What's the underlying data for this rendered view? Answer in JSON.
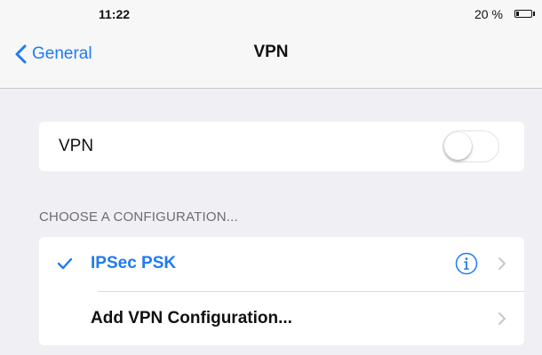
{
  "status_bar": {
    "time": "11:22",
    "battery_percent": "20 %",
    "battery_level": 0.2
  },
  "nav": {
    "back_label": "General",
    "title": "VPN"
  },
  "vpn_toggle": {
    "label": "VPN",
    "on": false
  },
  "configurations": {
    "header": "CHOOSE A CONFIGURATION...",
    "items": [
      {
        "label": "IPSec PSK",
        "selected": true,
        "has_info": true
      },
      {
        "label": "Add VPN Configuration...",
        "selected": false,
        "has_info": false
      }
    ]
  },
  "colors": {
    "accent": "#1f7bf2",
    "background": "#efeff4",
    "card": "#ffffff",
    "secondary_text": "#6d6d72"
  },
  "icons": {
    "back": "chevron-left-icon",
    "check": "checkmark-icon",
    "info": "info-icon",
    "disclosure": "chevron-right-icon",
    "battery": "battery-icon"
  }
}
